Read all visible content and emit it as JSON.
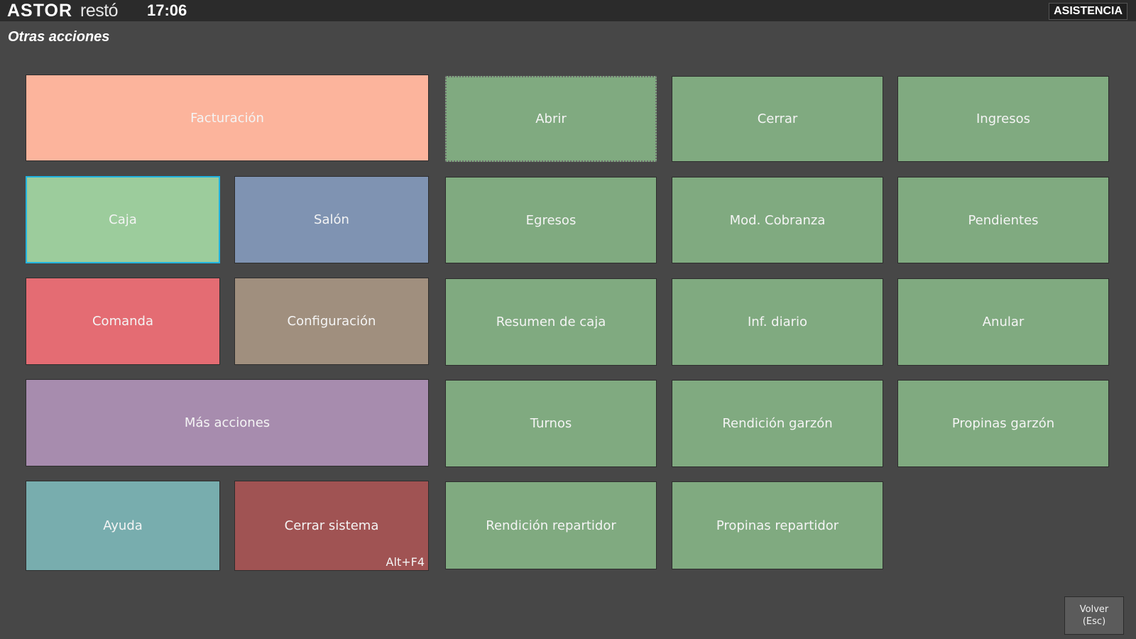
{
  "header": {
    "logo_main": "ASTOR",
    "logo_sub": "restó",
    "time": "17:06",
    "assist_label": "ASISTENCIA"
  },
  "page_title": "Otras acciones",
  "left_tiles": {
    "facturacion": "Facturación",
    "caja": "Caja",
    "salon": "Salón",
    "comanda": "Comanda",
    "configuracion": "Configuración",
    "mas_acciones": "Más acciones",
    "ayuda": "Ayuda",
    "cerrar_sistema": "Cerrar sistema",
    "cerrar_sistema_shortcut": "Alt+F4"
  },
  "caja_actions": [
    "Abrir",
    "Cerrar",
    "Ingresos",
    "Egresos",
    "Mod. Cobranza",
    "Pendientes",
    "Resumen de caja",
    "Inf. diario",
    "Anular",
    "Turnos",
    "Rendición garzón",
    "Propinas garzón",
    "Rendición repartidor",
    "Propinas repartidor"
  ],
  "volver": {
    "line1": "Volver",
    "line2": "(Esc)"
  },
  "colors": {
    "facturacion": "#fcb49c",
    "caja": "#9ccc9c",
    "salon": "#7f93b2",
    "comanda": "#e46c73",
    "configuracion": "#a08f7e",
    "mas_acciones": "#a78cae",
    "ayuda": "#78adae",
    "cerrar_sistema": "#a05353",
    "action_green": "#80aa80",
    "focus_border": "#22b4e0"
  }
}
